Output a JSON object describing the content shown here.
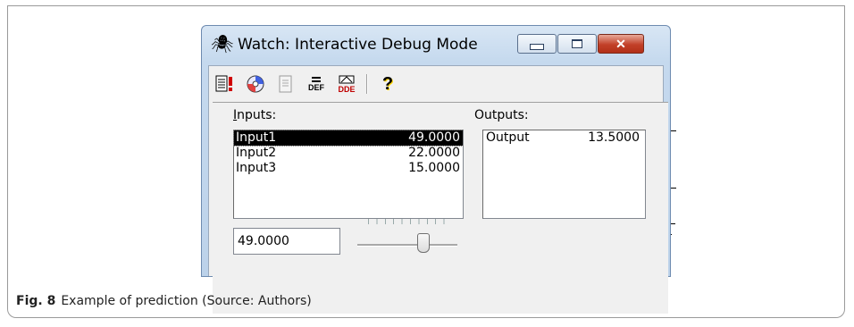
{
  "window": {
    "title": "Watch: Interactive Debug Mode",
    "minimize_label": "",
    "maximize_label": "",
    "close_label": "✕"
  },
  "toolbar": {
    "def_label": "DEF",
    "dde_label": "DDE",
    "help_glyph": "?"
  },
  "inputs": {
    "label_prefix": "I",
    "label_rest": "nputs:",
    "rows": [
      {
        "name": "Input1",
        "value": "49.0000"
      },
      {
        "name": "Input2",
        "value": "22.0000"
      },
      {
        "name": "Input3",
        "value": "15.0000"
      }
    ],
    "selected_index": 0
  },
  "outputs": {
    "label": "Outputs:",
    "rows": [
      {
        "name": "Output",
        "value": "13.5000"
      }
    ]
  },
  "value_field": "49.0000",
  "slider": {
    "value_fraction": 0.68
  },
  "caption": {
    "figure": "Fig. 8",
    "text": "Example of prediction (Source: Authors)"
  },
  "colors": {
    "title_bg": "#c5d9ee",
    "close_button": "#c24028",
    "selection": "#000000"
  }
}
